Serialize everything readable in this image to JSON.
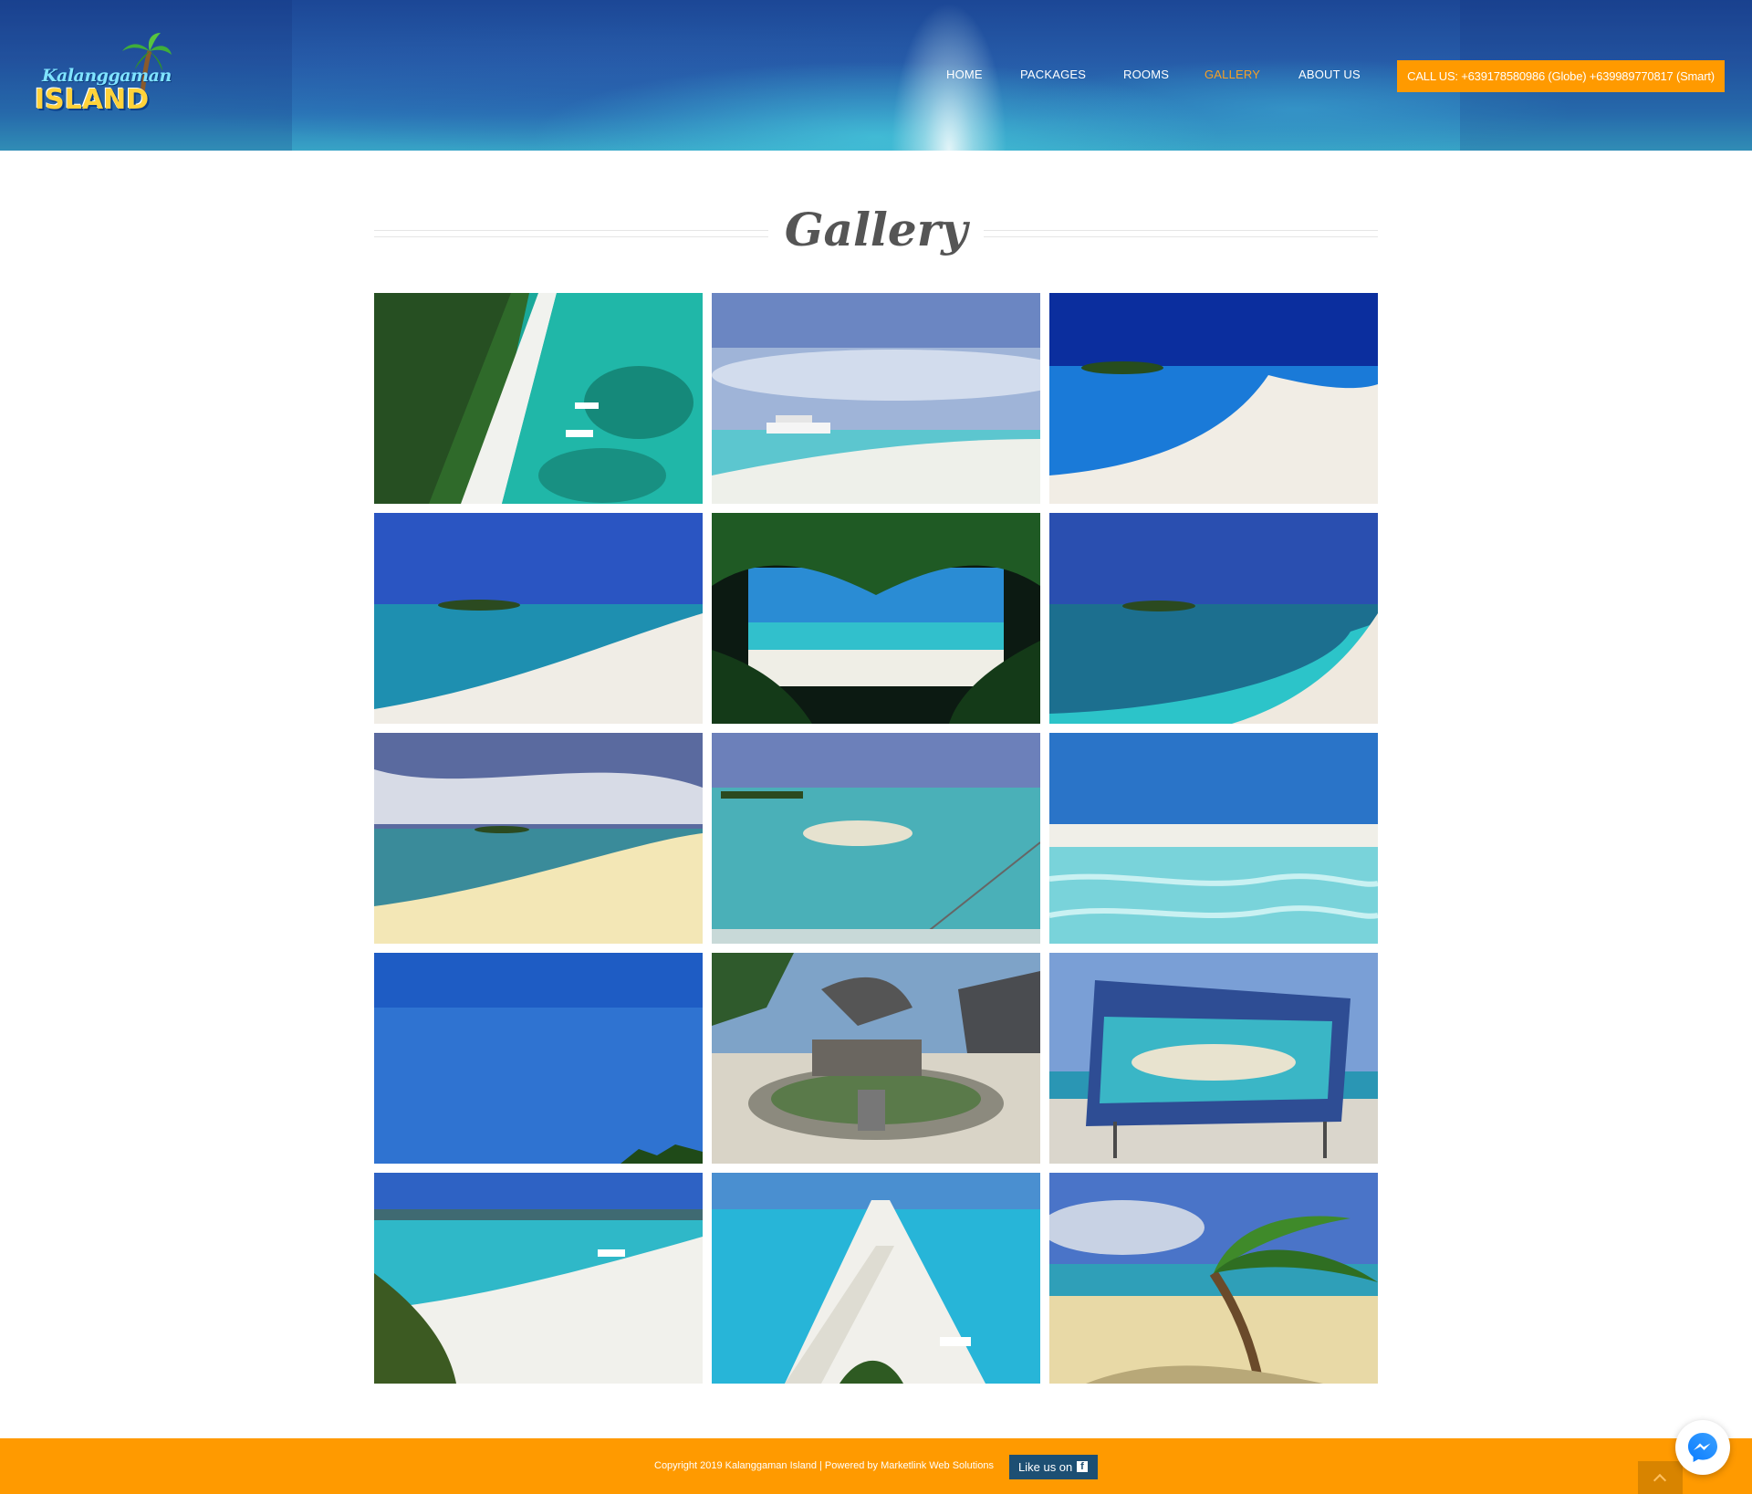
{
  "header": {
    "logo": {
      "script_text": "Kalanggaman",
      "block_text": "ISLAND"
    },
    "nav": [
      {
        "label": "HOME",
        "active": false
      },
      {
        "label": "PACKAGES",
        "active": false
      },
      {
        "label": "ROOMS",
        "active": false
      },
      {
        "label": "GALLERY",
        "active": true
      },
      {
        "label": "ABOUT US",
        "active": false
      }
    ],
    "call_button": "CALL US: +639178580986 (Globe) +639989770817 (Smart)"
  },
  "gallery": {
    "title": "Gallery",
    "images": [
      {
        "scene": "aerial-sandbar-with-boats"
      },
      {
        "scene": "boat-on-sandbar-cloudy-sky"
      },
      {
        "scene": "curved-white-sandbar-island"
      },
      {
        "scene": "island-across-turquoise-water"
      },
      {
        "scene": "palm-trees-framing-beach"
      },
      {
        "scene": "sandbar-curve-shallow-water"
      },
      {
        "scene": "dramatic-clouds-over-sandbar"
      },
      {
        "scene": "sandbar-in-clear-water-from-boat"
      },
      {
        "scene": "clear-shallow-water-beach"
      },
      {
        "scene": "blue-sky-with-palm-tips"
      },
      {
        "scene": "kalanggaman-sign-monument"
      },
      {
        "scene": "welcome-map-board"
      },
      {
        "scene": "aerial-beach-with-huts"
      },
      {
        "scene": "aerial-long-sandbar"
      },
      {
        "scene": "leaning-palm-on-beach"
      }
    ]
  },
  "footer": {
    "copyright": "Copyright 2019 Kalanggaman Island | Powered by Marketlink Web Solutions",
    "like_label": "Like us on",
    "like_icon_glyph": "f"
  },
  "colors": {
    "accent_orange": "#ff9a00",
    "nav_active": "#f7a025",
    "like_button_bg": "#1d4f73"
  }
}
